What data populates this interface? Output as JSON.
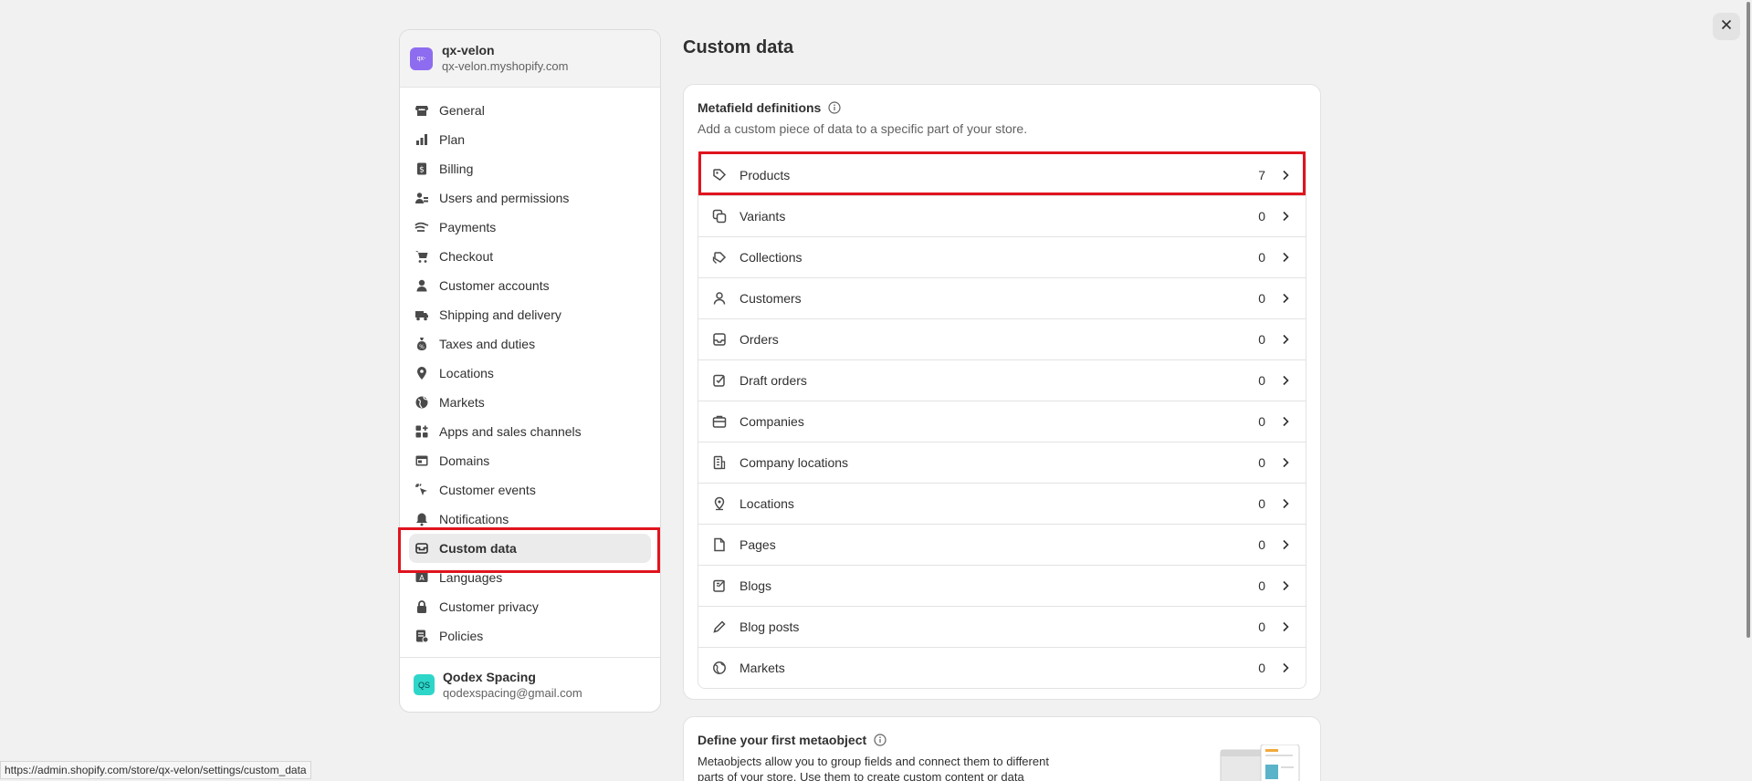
{
  "store": {
    "logo_text": "qx-",
    "name": "qx-velon",
    "domain": "qx-velon.myshopify.com"
  },
  "nav": [
    {
      "label": "General",
      "icon": "store-icon"
    },
    {
      "label": "Plan",
      "icon": "chart-bars-icon"
    },
    {
      "label": "Billing",
      "icon": "receipt-icon"
    },
    {
      "label": "Users and permissions",
      "icon": "users-icon"
    },
    {
      "label": "Payments",
      "icon": "payment-icon"
    },
    {
      "label": "Checkout",
      "icon": "cart-icon"
    },
    {
      "label": "Customer accounts",
      "icon": "person-icon"
    },
    {
      "label": "Shipping and delivery",
      "icon": "truck-icon"
    },
    {
      "label": "Taxes and duties",
      "icon": "tax-icon"
    },
    {
      "label": "Locations",
      "icon": "location-pin-icon"
    },
    {
      "label": "Markets",
      "icon": "globe-icon"
    },
    {
      "label": "Apps and sales channels",
      "icon": "apps-icon"
    },
    {
      "label": "Domains",
      "icon": "domain-icon"
    },
    {
      "label": "Customer events",
      "icon": "cursor-click-icon"
    },
    {
      "label": "Notifications",
      "icon": "bell-icon"
    },
    {
      "label": "Custom data",
      "icon": "database-icon",
      "active": true
    },
    {
      "label": "Languages",
      "icon": "language-icon"
    },
    {
      "label": "Customer privacy",
      "icon": "lock-icon"
    },
    {
      "label": "Policies",
      "icon": "policy-icon"
    }
  ],
  "user": {
    "initials": "QS",
    "name": "Qodex Spacing",
    "email": "qodexspacing@gmail.com"
  },
  "page": {
    "title": "Custom data"
  },
  "metafields": {
    "title": "Metafield definitions",
    "subtitle": "Add a custom piece of data to a specific part of your store.",
    "rows": [
      {
        "label": "Products",
        "count": "7",
        "icon": "tag-icon"
      },
      {
        "label": "Variants",
        "count": "0",
        "icon": "variants-icon"
      },
      {
        "label": "Collections",
        "count": "0",
        "icon": "collection-icon"
      },
      {
        "label": "Customers",
        "count": "0",
        "icon": "person-icon"
      },
      {
        "label": "Orders",
        "count": "0",
        "icon": "inbox-icon"
      },
      {
        "label": "Draft orders",
        "count": "0",
        "icon": "draft-order-icon"
      },
      {
        "label": "Companies",
        "count": "0",
        "icon": "company-icon"
      },
      {
        "label": "Company locations",
        "count": "0",
        "icon": "building-icon"
      },
      {
        "label": "Locations",
        "count": "0",
        "icon": "location-pin-icon"
      },
      {
        "label": "Pages",
        "count": "0",
        "icon": "page-icon"
      },
      {
        "label": "Blogs",
        "count": "0",
        "icon": "blog-icon"
      },
      {
        "label": "Blog posts",
        "count": "0",
        "icon": "pencil-icon"
      },
      {
        "label": "Markets",
        "count": "0",
        "icon": "globe-icon"
      }
    ]
  },
  "metaobject": {
    "title": "Define your first metaobject",
    "description": "Metaobjects allow you to group fields and connect them to different parts of your store. Use them to create custom content or data"
  },
  "status_url": "https://admin.shopify.com/store/qx-velon/settings/custom_data",
  "colors": {
    "highlight": "#e0141e",
    "store_logo": "#8e6cf0",
    "avatar": "#2ed6c9"
  }
}
